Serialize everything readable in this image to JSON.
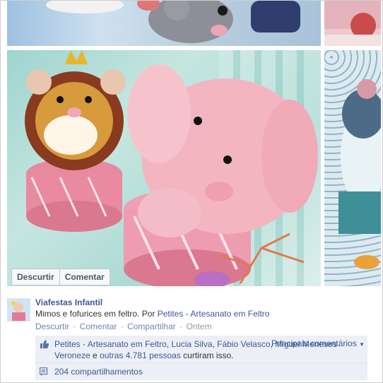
{
  "photo_buttons": {
    "untag": "Descurtir",
    "comment": "Comentar"
  },
  "post": {
    "author": "Viafestas Infantil",
    "text_prefix": "Mimos e fofurices em feltro. Por ",
    "text_link": "Petites - Artesanato em Feltro"
  },
  "actions": {
    "unlike": "Descurtir",
    "comment": "Comentar",
    "share": "Compartilhar",
    "time": "Ontem",
    "separator": "·"
  },
  "likes": {
    "name1": "Petites - Artesanato em Feltro",
    "name2": "Lucia Silva",
    "name3": "Fábio Velasco",
    "name4": "Miguel Meneses Veroneze",
    "others": "outras 4.781 pessoas",
    "suffix": "curtiram isso.",
    "top_comments": "Principais comentários",
    "comma": ", ",
    "and": " e "
  },
  "shares": {
    "text": "204 compartilhamentos"
  },
  "icons": {
    "like": "thumbs-up-icon",
    "share": "share-icon",
    "caret": "caret-down-icon"
  },
  "colors": {
    "link": "#3b5998",
    "ufi_bg": "#eceff5",
    "muted": "#999999"
  }
}
